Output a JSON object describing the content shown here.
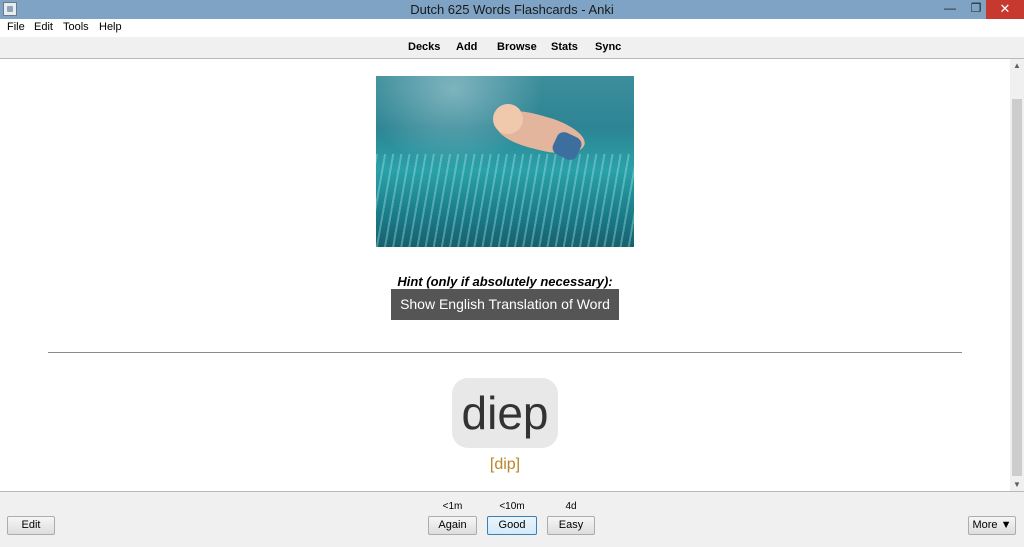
{
  "window": {
    "title": "Dutch 625 Words Flashcards - Anki",
    "minimize_glyph": "—",
    "maximize_glyph": "❐",
    "close_glyph": "✕"
  },
  "menu": [
    "File",
    "Edit",
    "Tools",
    "Help"
  ],
  "toolbar": [
    "Decks",
    "Add",
    "Browse",
    "Stats",
    "Sync"
  ],
  "card": {
    "hint_label": "Hint (only if absolutely necessary):",
    "hint_button": "Show English Translation of Word",
    "word": "diep",
    "pronunciation": "[dip]"
  },
  "answer": {
    "edit_label": "Edit",
    "more_label": "More ▼",
    "buttons": [
      {
        "due": "<1m",
        "label": "Again"
      },
      {
        "due": "<10m",
        "label": "Good"
      },
      {
        "due": "4d",
        "label": "Easy"
      }
    ]
  },
  "scrollbar": {
    "up_glyph": "▲",
    "down_glyph": "▼"
  },
  "colors": {
    "titlebar": "#7ea3c4",
    "close_button": "#c7382e",
    "hint_button_bg": "#555555",
    "pronunciation": "#b8862d",
    "word_box_bg": "#e8e8e8"
  }
}
